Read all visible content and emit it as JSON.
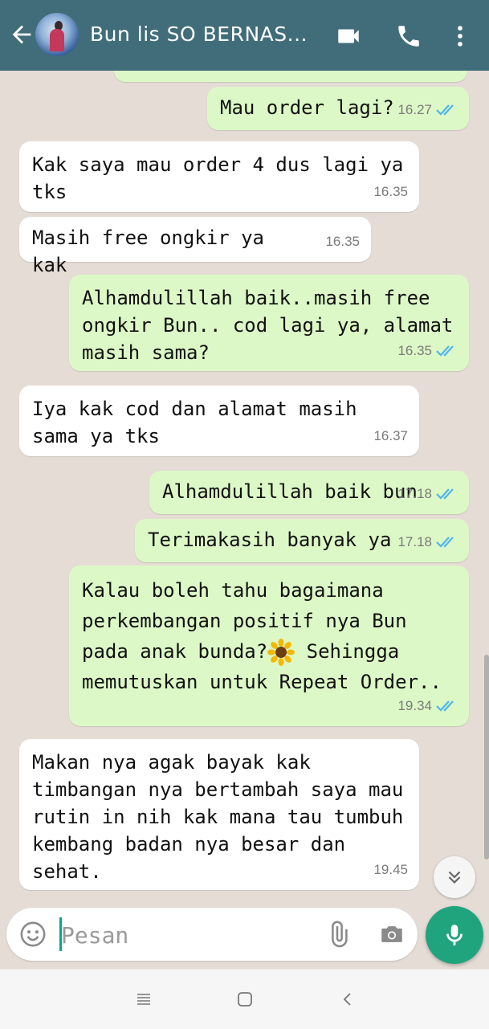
{
  "header": {
    "contact_name": "Bun lis SO BERNAS...",
    "bg_color": "#416d7a",
    "icons": [
      "back-arrow-icon",
      "video-call-icon",
      "phone-icon",
      "more-vert-icon"
    ]
  },
  "messages": [
    {
      "id": 1,
      "direction": "out",
      "text": "Mau order lagi?",
      "time": "16.27",
      "read": true
    },
    {
      "id": 2,
      "direction": "in",
      "text": "Kak saya mau order 4 dus lagi ya tks",
      "time": "16.35"
    },
    {
      "id": 3,
      "direction": "in",
      "text": "Masih free ongkir ya kak",
      "time": "16.35"
    },
    {
      "id": 4,
      "direction": "out",
      "text": "Alhamdulillah baik..masih free ongkir Bun.. cod lagi ya, alamat masih sama?",
      "time": "16.35",
      "read": true
    },
    {
      "id": 5,
      "direction": "in",
      "text": "Iya kak cod dan alamat masih sama ya tks",
      "time": "16.37"
    },
    {
      "id": 6,
      "direction": "out",
      "text": "Alhamdulillah baik bun",
      "time": "17.18",
      "read": true
    },
    {
      "id": 7,
      "direction": "out",
      "text": "Terimakasih banyak ya",
      "time": "17.18",
      "read": true
    },
    {
      "id": 8,
      "direction": "out",
      "text_before_emoji": "Kalau boleh tahu bagaimana perkembangan positif nya Bun pada anak bunda?",
      "emoji": "sunflower",
      "text_after_emoji": " Sehingga memutuskan untuk Repeat Order..",
      "time": "19.34",
      "read": true
    },
    {
      "id": 9,
      "direction": "in",
      "text": "Makan nya agak bayak kak timbangan nya bertambah saya mau rutin in nih kak mana tau tumbuh kembang badan nya besar dan sehat.",
      "time": "19.45"
    }
  ],
  "composer": {
    "placeholder": "Pesan",
    "icons": [
      "emoji-icon",
      "attach-icon",
      "camera-icon",
      "mic-icon"
    ]
  },
  "colors": {
    "incoming_bubble": "#ffffff",
    "outgoing_bubble": "#dcf8c6",
    "read_tick": "#4fb6ec",
    "accent": "#20a47e"
  }
}
